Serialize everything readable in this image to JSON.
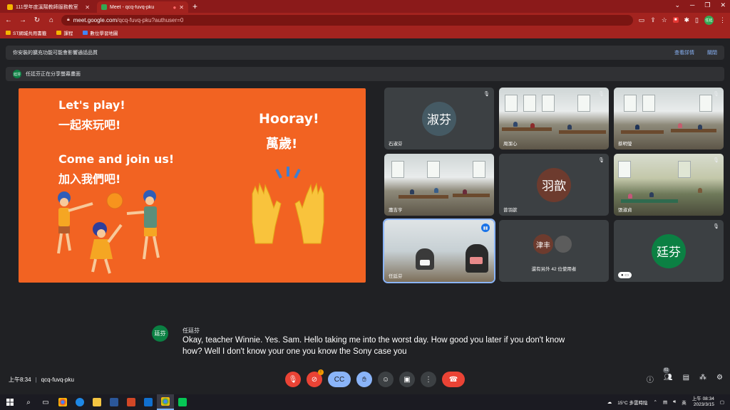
{
  "browser": {
    "tabs": [
      {
        "label": "111學年度溪陽教師服務教室",
        "fav_color": "#f4b400",
        "active": false
      },
      {
        "label": "Meet - qcq-fuvq-pku",
        "fav_color": "#34a853",
        "active": true
      }
    ],
    "url_host": "meet.google.com",
    "url_path": "/qcq-fuvq-pku?authuser=0",
    "profile_initials": "任廷",
    "bookmarks": [
      "ST網城共用書籤",
      "課程",
      "數位學習地圖"
    ]
  },
  "banners": {
    "audio_warning": "你安裝的擴充功能可能會影響通話品質",
    "view_details": "查看詳情",
    "close": "關閉",
    "presenter_avatar": "廷芬",
    "presenting_text": "任廷芬正在分享螢幕畫面"
  },
  "slide": {
    "line1": "Let's play!",
    "line2": "一起來玩吧!",
    "line3": "Come and join us!",
    "line4": "加入我們吧!",
    "line5": "Hooray!",
    "line6": "萬歲!"
  },
  "tiles": [
    {
      "name": "石淑芬",
      "avatar": "淑芬",
      "color": "#455a64"
    },
    {
      "name": "周潔心",
      "avatar": "",
      "color": ""
    },
    {
      "name": "蔡明瑩",
      "avatar": "",
      "color": ""
    },
    {
      "name": "蕭吉亨",
      "avatar": "",
      "color": ""
    },
    {
      "name": "曾羽歆",
      "avatar": "羽歆",
      "color": "#6d3b2e"
    },
    {
      "name": "張淑貞",
      "avatar": "",
      "color": ""
    },
    {
      "name": "任廷芬",
      "avatar": "",
      "color": ""
    },
    {
      "name": "還有另外 42 位使用者",
      "avatar": "津丰",
      "color": "#6d3b2e"
    },
    {
      "name": "",
      "avatar": "廷芬",
      "color": "#0b8043"
    }
  ],
  "caption": {
    "avatar": "廷芬",
    "speaker": "任廷芬",
    "text": "Okay, teacher Winnie. Yes. Sam. Hello taking me into the worst day. How good you later if you don't know how? Well I don't know your one you know the Sony case you"
  },
  "meeting": {
    "time": "上午8:34",
    "code": "qcq-fuvq-pku",
    "participant_count": "61"
  },
  "taskbar": {
    "weather": "15°C 多雲時陰",
    "ime": "英",
    "time": "上午 08:34",
    "date": "2023/3/15"
  },
  "colors": {
    "chrome_red": "#a3231f",
    "slide_orange": "#f26322",
    "end_call": "#ea4335",
    "accent_blue": "#8ab4f8"
  }
}
